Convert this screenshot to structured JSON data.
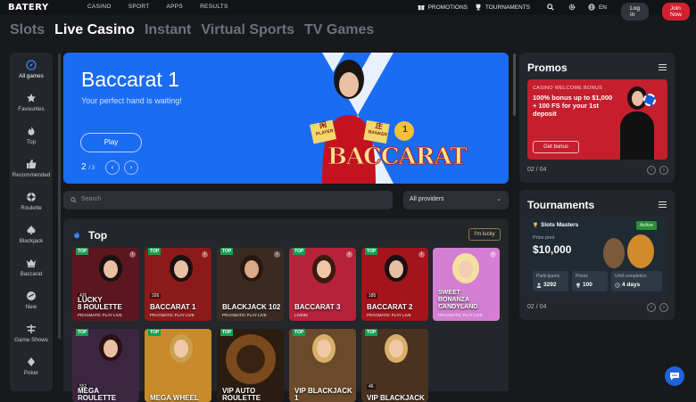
{
  "brand": "BATERY",
  "topnav": [
    "CASINO",
    "SPORT",
    "APPS",
    "RESULTS"
  ],
  "topright": {
    "promotions": "PROMOTIONS",
    "tournaments": "TOURNAMENTS",
    "lang": "EN",
    "login": "Log in",
    "join": "Join Now"
  },
  "category_tabs": [
    "Slots",
    "Live Casino",
    "Instant",
    "Virtual Sports",
    "TV Games"
  ],
  "active_tab": "Live Casino",
  "sidebar": [
    {
      "label": "All games",
      "icon": "compass-icon"
    },
    {
      "label": "Favourites",
      "icon": "star-icon"
    },
    {
      "label": "Top",
      "icon": "flame-icon"
    },
    {
      "label": "Recommended",
      "icon": "thumbs-up-icon"
    },
    {
      "label": "Roulette",
      "icon": "roulette-icon"
    },
    {
      "label": "Blackjack",
      "icon": "spade-icon"
    },
    {
      "label": "Baccarat",
      "icon": "crown-icon"
    },
    {
      "label": "New",
      "icon": "new-icon"
    },
    {
      "label": "Game Shows",
      "icon": "game-shows-icon"
    },
    {
      "label": "Poker",
      "icon": "poker-icon"
    }
  ],
  "hero": {
    "title": "Baccarat 1",
    "subtitle": "Your perfect hand is waiting!",
    "play": "Play",
    "page_current": "2",
    "page_total": "/ 3",
    "logo_text": "BACCARAT",
    "player_label": "PLAYER",
    "banker_label": "BANKER",
    "badge": "1",
    "player_glyph": "闲",
    "banker_glyph": "庄"
  },
  "search": {
    "placeholder": "Search"
  },
  "providers": {
    "value": "All providers"
  },
  "top_section": {
    "title": "Top",
    "lucky": "I'm lucky"
  },
  "games_row1": [
    {
      "name": "LUCKY\n8 ROULETTE",
      "provider": "PRAGMATIC PLAY LIVE",
      "tag": "TOP",
      "stat": "426",
      "bg": "#5c1620"
    },
    {
      "name": "BACCARAT 1",
      "provider": "PRAGMATIC PLAY LIVE",
      "tag": "TOP",
      "stat": "326",
      "bg": "#8c1a1a"
    },
    {
      "name": "BLACKJACK 102",
      "provider": "PRAGMATIC PLAY LIVE",
      "tag": "TOP",
      "stat": "",
      "bg": "#3a2a22"
    },
    {
      "name": "BACCARAT 3",
      "provider": "LIVE88",
      "tag": "TOP",
      "stat": "",
      "bg": "#b5223a"
    },
    {
      "name": "BACCARAT 2",
      "provider": "PRAGMATIC PLAY LIVE",
      "tag": "TOP",
      "stat": "185",
      "bg": "#a3141c"
    },
    {
      "name": "SWEET\nBONANZA CANDYLAND",
      "provider": "PRAGMATIC PLAY LIVE",
      "tag": "",
      "stat": "",
      "bg": "#d47fd3"
    }
  ],
  "games_row2": [
    {
      "name": "MEGA ROULETTE",
      "tag": "TOP",
      "stat": "552",
      "bg": "#3c2540"
    },
    {
      "name": "MEGA WHEEL",
      "tag": "TOP",
      "stat": "",
      "bg": "#c88a2a"
    },
    {
      "name": "VIP AUTO\nROULETTE",
      "tag": "TOP",
      "stat": "",
      "bg": "#2b1c12"
    },
    {
      "name": "VIP BLACKJACK 1",
      "tag": "TOP",
      "stat": "",
      "bg": "#6a4a2a"
    },
    {
      "name": "VIP BLACKJACK",
      "tag": "TOP",
      "stat": "46",
      "bg": "#4a3220"
    }
  ],
  "promos": {
    "title": "Promos",
    "kicker": "CASINO WELCOME BONUS",
    "headline": "100% bonus up to $1,000 + 100 FS for your 1st deposit",
    "button": "Get bonus",
    "pager": "02 / 04"
  },
  "tournaments": {
    "title": "Tournaments",
    "name": "Slots Masters",
    "status": "Active",
    "prize_label": "Prize pool",
    "prize": "$10,000",
    "participants_label": "Participants",
    "participants": "3292",
    "prizes_label": "Prizes",
    "prizes": "100",
    "until_label": "Until completion",
    "until": "4 days",
    "pager": "02 / 04"
  },
  "colors": {
    "accent": "#1a6cf2",
    "join": "#d3202f",
    "panel": "#23262b",
    "bg": "#17191d"
  }
}
